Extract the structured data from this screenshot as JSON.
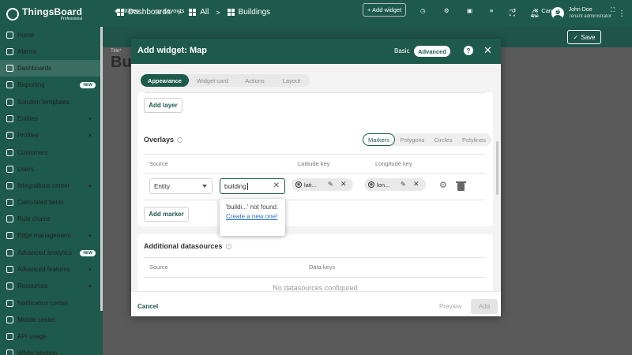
{
  "topbar": {
    "logo_name": "ThingsBoard",
    "logo_sub": "Professional",
    "breadcrumbs": [
      "Dashboards",
      "All",
      "Buildings"
    ],
    "user_name": "John Doe",
    "user_role": "Tenant administrator"
  },
  "sidebar": {
    "items": [
      {
        "label": "Home"
      },
      {
        "label": "Alarms"
      },
      {
        "label": "Dashboards"
      },
      {
        "label": "Reporting",
        "badge": "NEW"
      },
      {
        "label": "Solution templates"
      },
      {
        "label": "Entities"
      },
      {
        "label": "Profiles"
      },
      {
        "label": "Customers"
      },
      {
        "label": "Users"
      },
      {
        "label": "Integrations center"
      },
      {
        "label": "Calculated fields"
      },
      {
        "label": "Rule chains"
      },
      {
        "label": "Edge management"
      },
      {
        "label": "Advanced analytics",
        "badge": "NEW"
      },
      {
        "label": "Advanced features"
      },
      {
        "label": "Resources"
      },
      {
        "label": "Notification center"
      },
      {
        "label": "Mobile center"
      },
      {
        "label": "API usage"
      },
      {
        "label": "White labeling"
      }
    ]
  },
  "dashboard": {
    "toolbar": {
      "states": "States",
      "layouts": "Layouts",
      "add_widget": "+ Add widget",
      "cancel": "Cancel",
      "save": "Save"
    },
    "bg_title_label": "Title*",
    "bg_title": "Bui"
  },
  "modal": {
    "title": "Add widget:  Map",
    "mode_basic": "Basic",
    "mode_advanced": "Advanced",
    "tabs": [
      "Appearance",
      "Widget card",
      "Actions",
      "Layout"
    ],
    "add_layer": "Add layer",
    "overlays": {
      "title": "Overlays",
      "types": [
        "Markers",
        "Polygons",
        "Circles",
        "Polylines"
      ],
      "col_source": "Source",
      "col_lat": "Latitude key",
      "col_lon": "Longitude key",
      "source_value": "Entity",
      "entity_input": "building",
      "lat_chip": "lati...",
      "lon_chip": "lon...",
      "add_marker": "Add marker"
    },
    "popup": {
      "text": "'buildi...' not found.",
      "link": "Create a new one!"
    },
    "additional": {
      "title": "Additional datasources",
      "col_source": "Source",
      "col_keys": "Data keys",
      "empty": "No datasources configured"
    },
    "footer": {
      "cancel": "Cancel",
      "preview": "Preview",
      "add": "Add"
    }
  }
}
